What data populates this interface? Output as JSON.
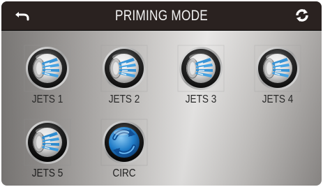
{
  "header": {
    "title": "PRIMING MODE",
    "back_icon": "back-arrow-icon",
    "sync_icon": "sync-icon"
  },
  "tiles": [
    {
      "label": "JETS 1",
      "icon": "jets-icon"
    },
    {
      "label": "JETS 2",
      "icon": "jets-icon"
    },
    {
      "label": "JETS 3",
      "icon": "jets-icon"
    },
    {
      "label": "JETS 4",
      "icon": "jets-icon"
    },
    {
      "label": "JETS 5",
      "icon": "jets-icon"
    },
    {
      "label": "CIRC",
      "icon": "circulation-icon"
    }
  ],
  "colors": {
    "header_bg": "#2a2220",
    "accent_blue": "#2a8fd8",
    "label": "#1e1e1e"
  }
}
